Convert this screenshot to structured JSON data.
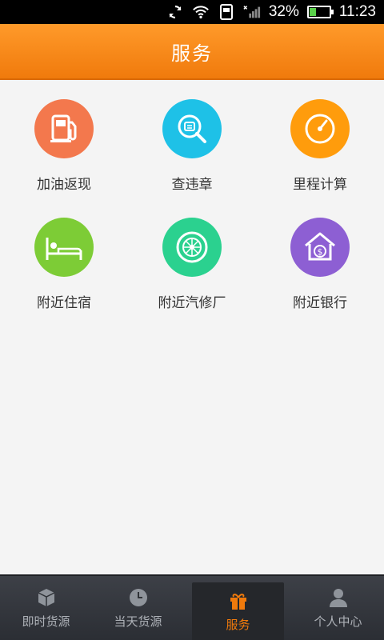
{
  "status_bar": {
    "battery_percent": "32%",
    "time": "11:23",
    "battery_level": 0.32
  },
  "header": {
    "title": "服务"
  },
  "services": [
    {
      "label": "加油返现",
      "icon": "fuel-pump-icon",
      "color": "#f3784d"
    },
    {
      "label": "查违章",
      "icon": "search-icon",
      "color": "#1ec1e7"
    },
    {
      "label": "里程计算",
      "icon": "gauge-icon",
      "color": "#ff9c0c"
    },
    {
      "label": "附近住宿",
      "icon": "bed-icon",
      "color": "#7dcc36"
    },
    {
      "label": "附近汽修厂",
      "icon": "tire-icon",
      "color": "#2bd18f"
    },
    {
      "label": "附近银行",
      "icon": "bank-icon",
      "color": "#8d5fd3"
    }
  ],
  "bottom_nav": [
    {
      "label": "即时货源",
      "icon": "box-icon",
      "active": false
    },
    {
      "label": "当天货源",
      "icon": "clock-icon",
      "active": false
    },
    {
      "label": "服务",
      "icon": "gift-icon",
      "active": true
    },
    {
      "label": "个人中心",
      "icon": "person-icon",
      "active": false
    }
  ],
  "colors": {
    "accent": "#f07a0c",
    "nav_bg": "#34373d",
    "page_bg": "#f4f4f4"
  }
}
